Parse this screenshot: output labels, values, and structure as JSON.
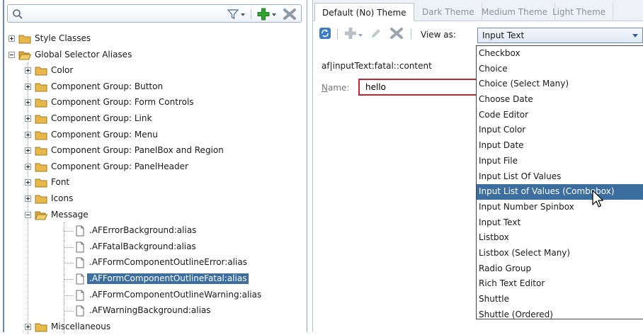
{
  "search": {
    "placeholder": ""
  },
  "tree": {
    "items": [
      {
        "label": "Style Classes"
      },
      {
        "label": "Global Selector Aliases"
      },
      {
        "label": "Color"
      },
      {
        "label": "Component Group: Button"
      },
      {
        "label": "Component Group: Form Controls"
      },
      {
        "label": "Component Group: Link"
      },
      {
        "label": "Component Group: Menu"
      },
      {
        "label": "Component Group: PanelBox and Region"
      },
      {
        "label": "Component Group: PanelHeader"
      },
      {
        "label": "Font"
      },
      {
        "label": "Icons"
      },
      {
        "label": "Message"
      },
      {
        "label": ".AFErrorBackground:alias"
      },
      {
        "label": ".AFFatalBackground:alias"
      },
      {
        "label": ".AFFormComponentOutlineError:alias"
      },
      {
        "label": ".AFFormComponentOutlineFatal:alias"
      },
      {
        "label": ".AFFormComponentOutlineWarning:alias"
      },
      {
        "label": ".AFWarningBackground:alias"
      },
      {
        "label": "Miscellaneous"
      }
    ]
  },
  "tabs": [
    {
      "label": "Default (No) Theme"
    },
    {
      "label": "Dark Theme"
    },
    {
      "label": "Medium Theme"
    },
    {
      "label": "Light Theme"
    }
  ],
  "toolbar": {
    "view_as_label": "View as:",
    "view_as_value": "Input Text"
  },
  "editor": {
    "selector": "af|inputText:fatal::content",
    "name_label_underlined": "N",
    "name_label_rest": "ame:",
    "name_value": "hello"
  },
  "dropdown": {
    "options": [
      "Checkbox",
      "Choice",
      "Choice (Select Many)",
      "Choose Date",
      "Code Editor",
      "Input Color",
      "Input Date",
      "Input File",
      "Input List Of Values",
      "Input List of Values (Combobox)",
      "Input Number Spinbox",
      "Input Text",
      "Listbox",
      "Listbox (Select Many)",
      "Radio Group",
      "Rich Text Editor",
      "Shuttle",
      "Shuttle (Ordered)"
    ],
    "hovered": "Input List of Values (Combobox)"
  },
  "colors": {
    "selection": "#3d6ea0",
    "folder": "#e8b84a",
    "error_border": "#c7242c",
    "add_green": "#2fa52f"
  }
}
